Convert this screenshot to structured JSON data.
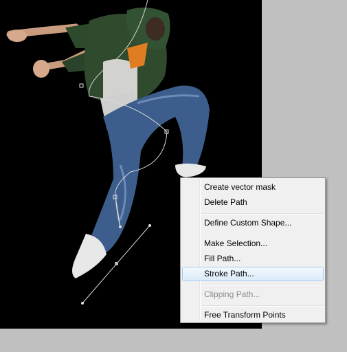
{
  "context_menu": {
    "items": [
      {
        "label": "Create vector mask"
      },
      {
        "label": "Delete Path"
      },
      {
        "label": "Define Custom Shape..."
      },
      {
        "label": "Make Selection..."
      },
      {
        "label": "Fill Path..."
      },
      {
        "label": "Stroke Path..."
      },
      {
        "label": "Clipping Path..."
      },
      {
        "label": "Free Transform Points"
      }
    ],
    "highlighted_item": "Stroke Path...",
    "disabled_item": "Clipping Path..."
  },
  "colors": {
    "canvas_bg": "#000000",
    "workspace_bg": "#c0c0c0",
    "hoodie": "#2f4a2c",
    "jeans": "#3f5f8a",
    "path_stroke": "#d8d8d8"
  }
}
